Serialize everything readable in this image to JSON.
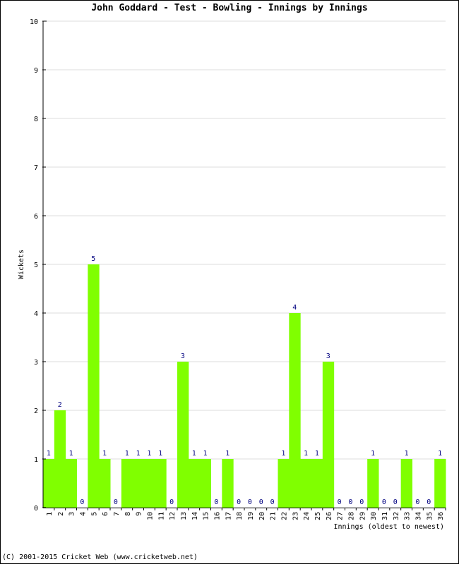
{
  "chart_data": {
    "type": "bar",
    "title": "John Goddard - Test - Bowling - Innings by Innings",
    "xlabel": "Innings (oldest to newest)",
    "ylabel": "Wickets",
    "ylim": [
      0,
      10
    ],
    "yticks": [
      0,
      1,
      2,
      3,
      4,
      5,
      6,
      7,
      8,
      9,
      10
    ],
    "grid": true,
    "bar_color": "#80ff00",
    "label_color": "#000080",
    "categories": [
      "1",
      "2",
      "3",
      "4",
      "5",
      "6",
      "7",
      "8",
      "9",
      "10",
      "11",
      "12",
      "13",
      "14",
      "15",
      "16",
      "17",
      "18",
      "19",
      "20",
      "21",
      "22",
      "23",
      "24",
      "25",
      "26",
      "27",
      "28",
      "29",
      "30",
      "31",
      "32",
      "33",
      "34",
      "35",
      "36"
    ],
    "values": [
      1,
      2,
      1,
      0,
      5,
      1,
      0,
      1,
      1,
      1,
      1,
      0,
      3,
      1,
      1,
      0,
      1,
      0,
      0,
      0,
      0,
      1,
      4,
      1,
      1,
      3,
      0,
      0,
      0,
      1,
      0,
      0,
      1,
      0,
      0,
      1
    ]
  },
  "footer": "(C) 2001-2015 Cricket Web (www.cricketweb.net)"
}
